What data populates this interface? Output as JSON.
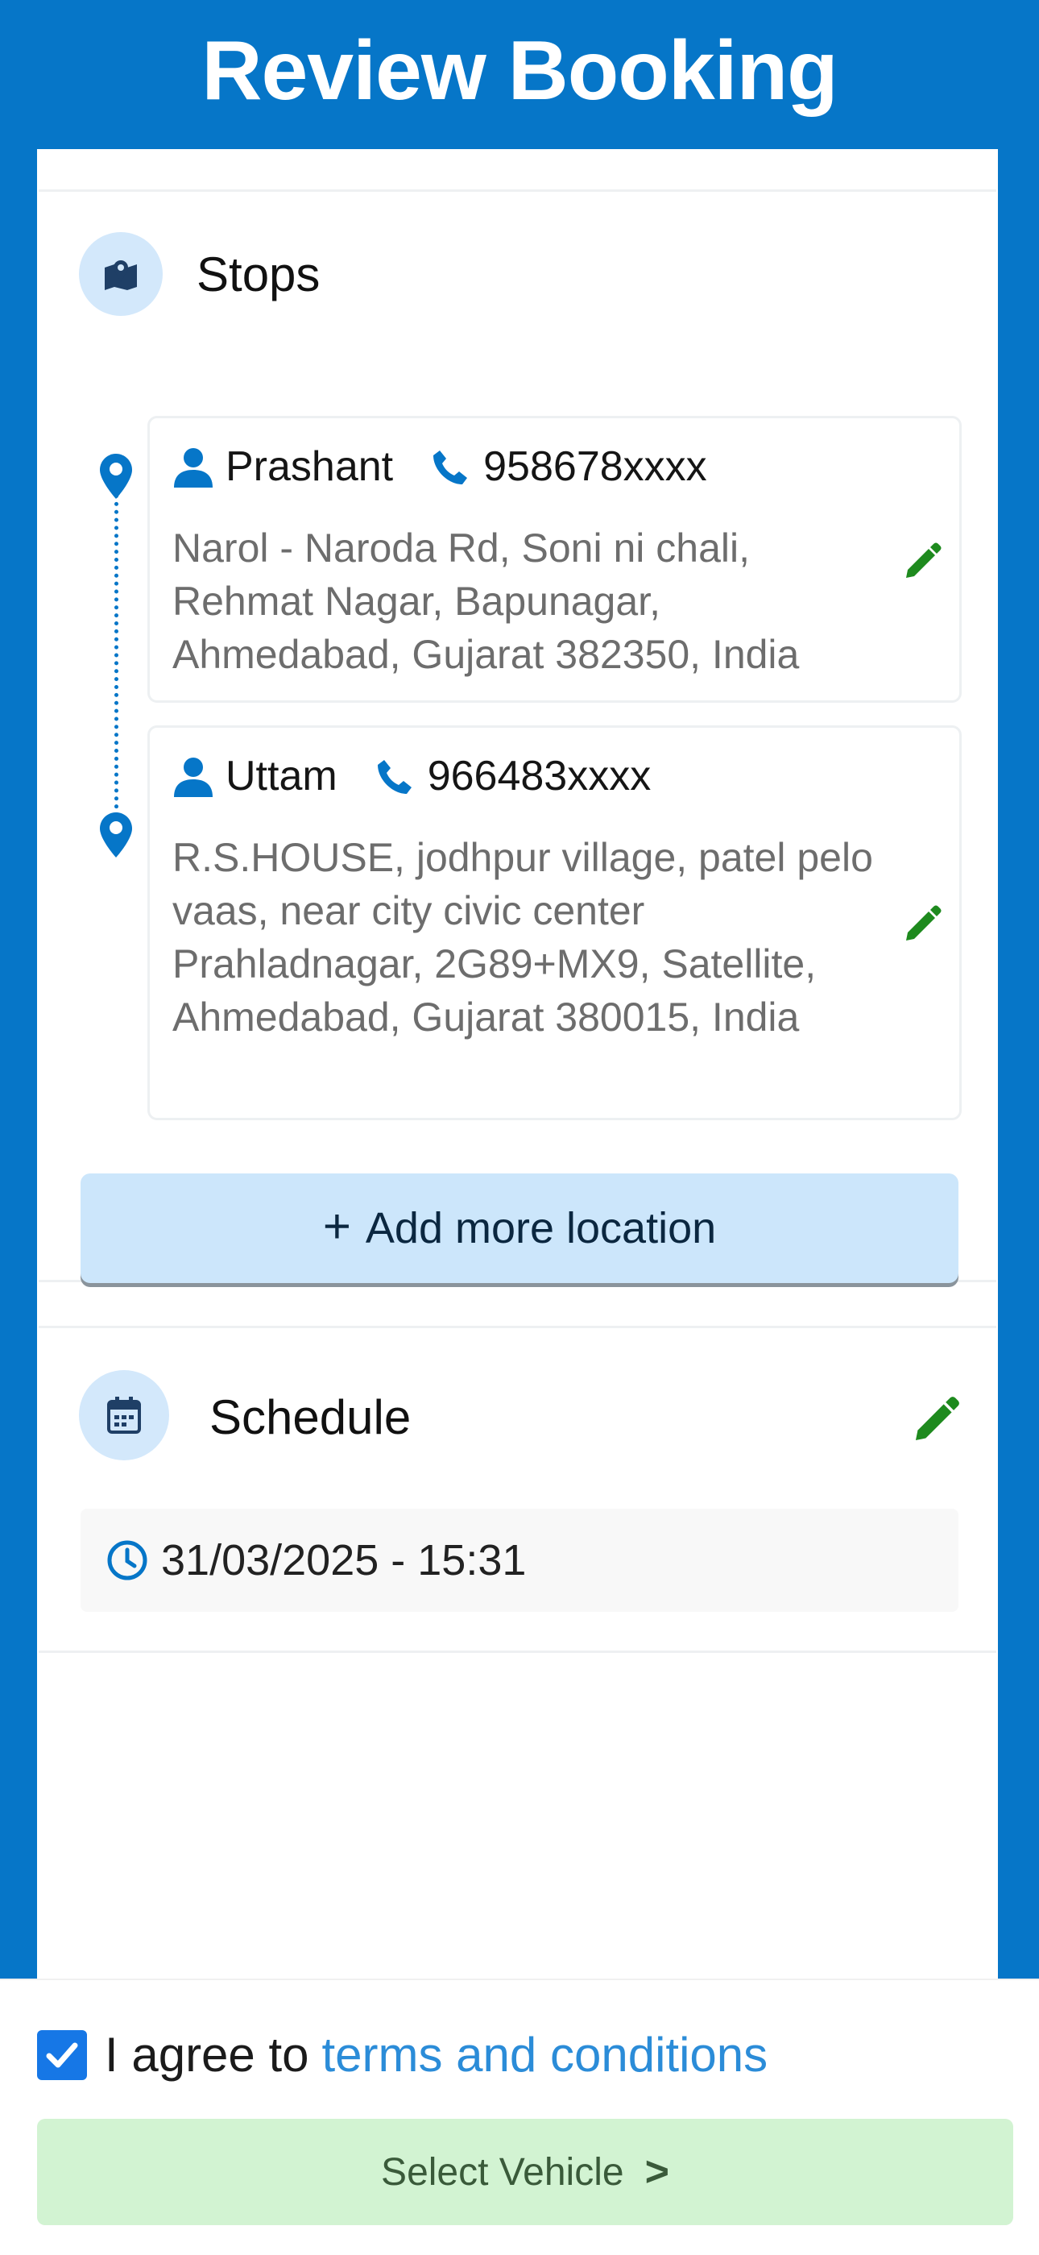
{
  "header": {
    "title": "Review Booking"
  },
  "stops": {
    "title": "Stops",
    "items": [
      {
        "name": "Prashant",
        "phone": "958678xxxx",
        "address": "Narol - Naroda Rd, Soni ni chali, Rehmat Nagar, Bapunagar, Ahmedabad, Gujarat 382350, India"
      },
      {
        "name": "Uttam",
        "phone": "966483xxxx",
        "address": "R.S.HOUSE, jodhpur village, patel pelo vaas, near city civic center Prahladnagar, 2G89+MX9, Satellite, Ahmedabad, Gujarat 380015, India"
      }
    ],
    "add_label": "Add more location"
  },
  "schedule": {
    "title": "Schedule",
    "datetime": "31/03/2025 - 15:31"
  },
  "footer": {
    "agree_text": "I agree to",
    "terms_text": "terms and conditions",
    "agree_checked": true,
    "select_label": "Select Vehicle",
    "select_chevron": ">"
  },
  "colors": {
    "primary": "#0676c8",
    "edit": "#1e8a1e",
    "add_bg": "#cce6fb",
    "select_bg": "#d2f3d2"
  }
}
